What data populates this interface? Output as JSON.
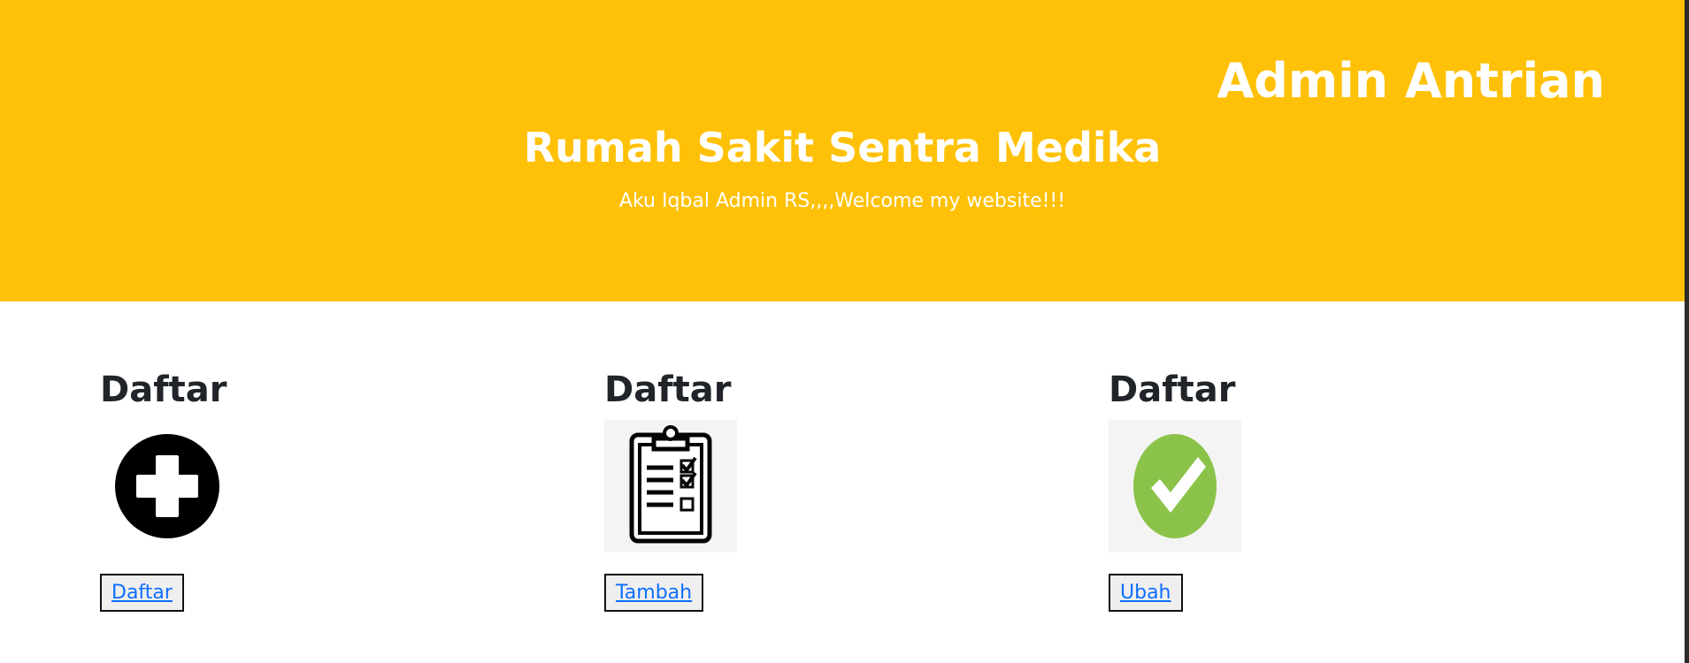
{
  "header": {
    "admin_title": "Admin Antrian",
    "title": "Rumah Sakit Sentra Medika",
    "subtitle": "Aku Iqbal Admin RS,,,,Welcome my website!!!",
    "background_color": "#ffc107"
  },
  "cards": [
    {
      "heading": "Daftar",
      "icon": "plus-circle-icon",
      "button_label": "Daftar"
    },
    {
      "heading": "Daftar",
      "icon": "clipboard-checklist-icon",
      "button_label": "Tambah"
    },
    {
      "heading": "Daftar",
      "icon": "check-badge-icon",
      "button_label": "Ubah"
    }
  ],
  "colors": {
    "header_text": "#ffffff",
    "heading_text": "#212529",
    "link": "#0d6efd",
    "check_badge": "#8bc34a"
  }
}
